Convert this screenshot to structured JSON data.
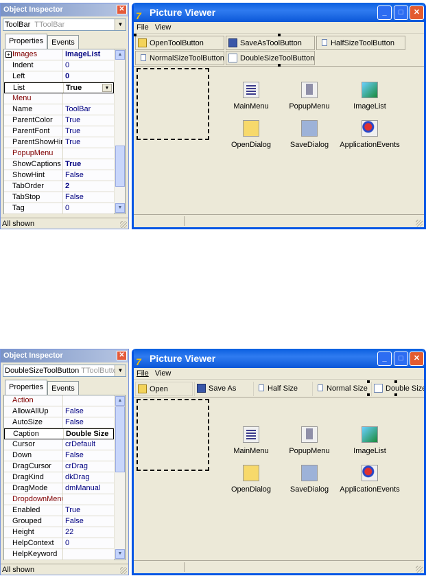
{
  "top": {
    "inspector": {
      "title": "Object Inspector",
      "close_glyph": "✕",
      "component_name": "ToolBar",
      "component_type": "TToolBar",
      "tabs": [
        "Properties",
        "Events"
      ],
      "rows": [
        {
          "name": "Images",
          "value": "ImageList",
          "kind": "event",
          "bold": true,
          "expand": "+"
        },
        {
          "name": "Indent",
          "value": "0"
        },
        {
          "name": "Left",
          "value": "0",
          "bold": true
        },
        {
          "name": "List",
          "value": "True",
          "selected": true
        },
        {
          "name": "Menu",
          "value": "",
          "kind": "event"
        },
        {
          "name": "Name",
          "value": "ToolBar"
        },
        {
          "name": "ParentColor",
          "value": "True"
        },
        {
          "name": "ParentFont",
          "value": "True"
        },
        {
          "name": "ParentShowHint",
          "value": "True"
        },
        {
          "name": "PopupMenu",
          "value": "",
          "kind": "event"
        },
        {
          "name": "ShowCaptions",
          "value": "True",
          "bold": true
        },
        {
          "name": "ShowHint",
          "value": "False"
        },
        {
          "name": "TabOrder",
          "value": "2",
          "bold": true
        },
        {
          "name": "TabStop",
          "value": "False"
        },
        {
          "name": "Tag",
          "value": "0"
        }
      ],
      "status": "All shown"
    },
    "viewer": {
      "title": "Picture Viewer",
      "menu": [
        "File",
        "View"
      ],
      "toolbar_buttons": [
        {
          "label": "OpenToolButton",
          "icon": "folder-icon"
        },
        {
          "label": "SaveAsToolButton",
          "icon": "disk-icon"
        },
        {
          "label": "HalfSizeToolButton",
          "icon": "page-icon"
        },
        {
          "label": "NormalSizeToolButton",
          "icon": "page-icon"
        },
        {
          "label": "DoubleSizeToolButton",
          "icon": "page-icon"
        }
      ],
      "components": [
        "MainMenu",
        "PopupMenu",
        "ImageList",
        "OpenDialog",
        "SaveDialog",
        "ApplicationEvents"
      ]
    }
  },
  "bottom": {
    "inspector": {
      "title": "Object Inspector",
      "close_glyph": "✕",
      "component_name": "DoubleSizeToolButton",
      "component_type": "TToolButto",
      "tabs": [
        "Properties",
        "Events"
      ],
      "rows": [
        {
          "name": "Action",
          "value": "",
          "kind": "event"
        },
        {
          "name": "AllowAllUp",
          "value": "False"
        },
        {
          "name": "AutoSize",
          "value": "False"
        },
        {
          "name": "Caption",
          "value": "Double Size",
          "selected": true
        },
        {
          "name": "Cursor",
          "value": "crDefault"
        },
        {
          "name": "Down",
          "value": "False"
        },
        {
          "name": "DragCursor",
          "value": "crDrag"
        },
        {
          "name": "DragKind",
          "value": "dkDrag"
        },
        {
          "name": "DragMode",
          "value": "dmManual"
        },
        {
          "name": "DropdownMenu",
          "value": "",
          "kind": "event"
        },
        {
          "name": "Enabled",
          "value": "True"
        },
        {
          "name": "Grouped",
          "value": "False"
        },
        {
          "name": "Height",
          "value": "22"
        },
        {
          "name": "HelpContext",
          "value": "0"
        },
        {
          "name": "HelpKeyword",
          "value": ""
        }
      ],
      "status": "All shown"
    },
    "viewer": {
      "title": "Picture Viewer",
      "menu": [
        "File",
        "View"
      ],
      "toolbar_buttons": [
        {
          "label": "Open",
          "icon": "folder-icon"
        },
        {
          "label": "Save As",
          "icon": "disk-icon"
        },
        {
          "label": "Half Size",
          "icon": "page-icon"
        },
        {
          "label": "Normal Size",
          "icon": "page-icon"
        },
        {
          "label": "Double Size",
          "icon": "page-icon"
        }
      ],
      "components": [
        "MainMenu",
        "PopupMenu",
        "ImageList",
        "OpenDialog",
        "SaveDialog",
        "ApplicationEvents"
      ]
    }
  },
  "window_buttons": {
    "minimize": "_",
    "maximize": "□",
    "close": "✕"
  },
  "glyphs": {
    "up": "▲",
    "down": "▼"
  }
}
